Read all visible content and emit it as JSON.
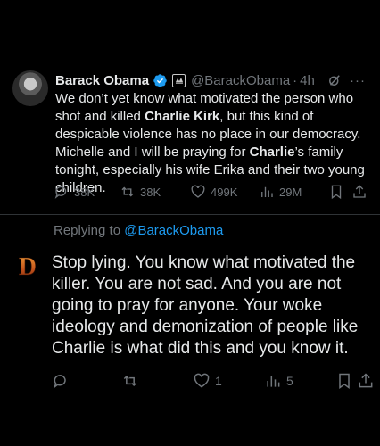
{
  "tweet": {
    "author_name": "Barack Obama",
    "handle": "@BarackObama",
    "separator": "·",
    "time": "4h",
    "more": "···",
    "text_parts": [
      {
        "t": "We don’t yet know what motivated the person who shot and killed ",
        "b": false
      },
      {
        "t": "Charlie Kirk",
        "b": true
      },
      {
        "t": ", but this kind of despicable violence has no place in our democracy. Michelle and I will be praying for ",
        "b": false
      },
      {
        "t": "Charlie",
        "b": true
      },
      {
        "t": "’s family tonight, especially his wife Erika and their two young children.",
        "b": false
      }
    ],
    "replies": "38K",
    "reposts": "38K",
    "likes": "499K",
    "views": "29M"
  },
  "reply": {
    "replying_prefix": "Replying to ",
    "replying_mention": "@BarackObama",
    "avatar_letter": "D",
    "text": "Stop lying. You know what motivated the killer. You are not sad. And you are not going to pray for anyone. Your woke ideology and demonization of people like Charlie is what did this and you know it.",
    "likes": "1",
    "views": "5"
  },
  "colors": {
    "background": "#000000",
    "text": "#e7e9ea",
    "muted": "#71767b",
    "link": "#1d9bf0",
    "verified": "#1d9bf0",
    "divider": "#2f3336"
  }
}
